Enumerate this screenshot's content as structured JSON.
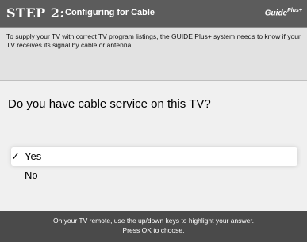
{
  "header": {
    "step": "STEP 2:",
    "title": "Configuring for Cable",
    "brand": "Guide",
    "brand_mark": "Plus+"
  },
  "info": {
    "text": "To supply your TV with correct TV program listings, the GUIDE Plus+ system needs to know if your TV receives its signal by cable or antenna."
  },
  "question": {
    "text": "Do you have cable service on this TV?"
  },
  "options": [
    {
      "label": "Yes",
      "check": "✓",
      "selected": true
    },
    {
      "label": "No",
      "check": "",
      "selected": false
    }
  ],
  "footer": {
    "line1": "On your TV remote, use the up/down keys to highlight your answer.",
    "line2": "Press OK to choose."
  },
  "colors": {
    "title_bar": "#5c5c5c",
    "info_panel": "#e2e2e2",
    "question_area": "#f0f0f0",
    "footer": "#4a4a4a",
    "selected_option": "#ffffff"
  }
}
